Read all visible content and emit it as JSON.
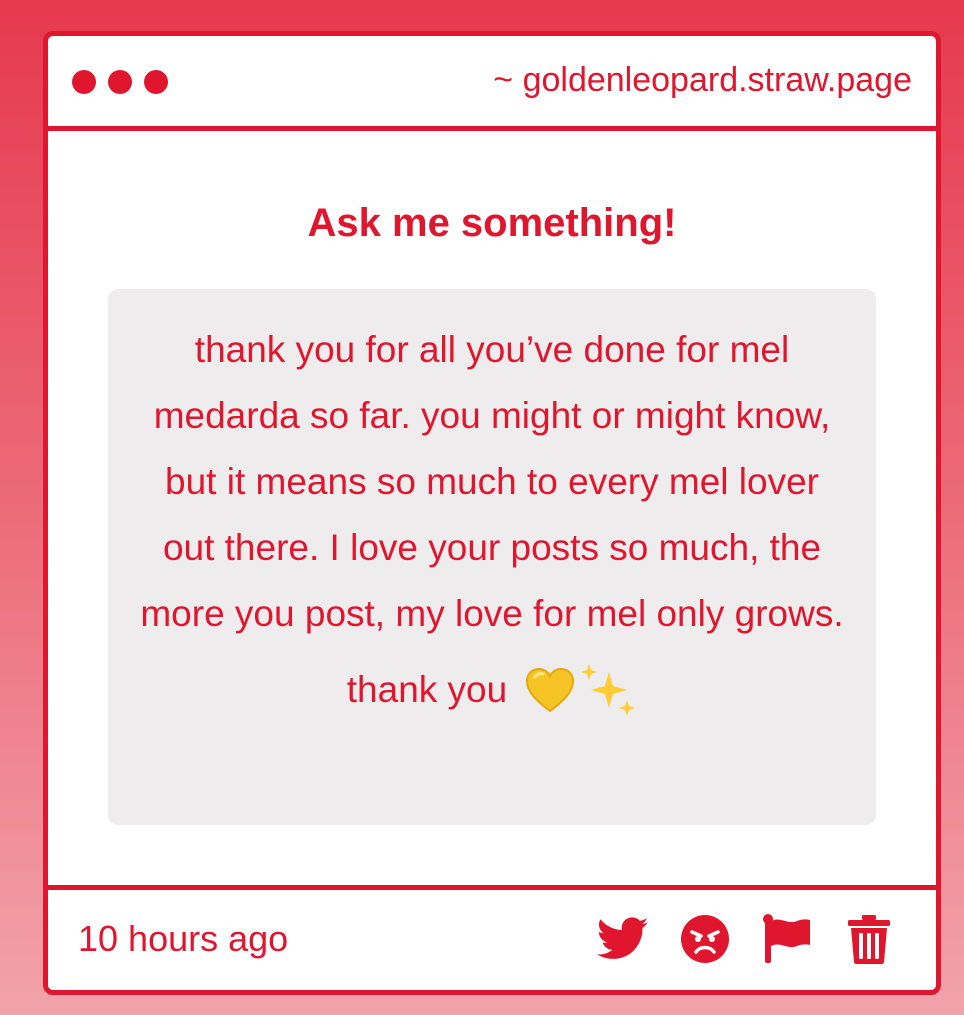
{
  "window": {
    "url": "~ goldenleopard.straw.page",
    "dots": [
      "dot",
      "dot",
      "dot"
    ]
  },
  "page": {
    "title": "Ask me something!"
  },
  "question": {
    "text": "thank you for all you’ve done for mel medarda so far. you might or might know, but it means so much to every mel lover out there. I love your posts so much, the more you post, my love for mel only grows.",
    "sign_off": "thank you",
    "emojis": [
      "yellow-heart-icon",
      "sparkles-icon"
    ]
  },
  "footer": {
    "timestamp": "10 hours ago",
    "actions": [
      "twitter-icon",
      "angry-face-icon",
      "flag-icon",
      "trash-icon"
    ]
  },
  "colors": {
    "accent": "#e0162f",
    "card_background": "#ffffff",
    "question_background": "#eeecec",
    "page_gradient_top": "#e6394e",
    "page_gradient_bottom": "#f2a3ab"
  }
}
